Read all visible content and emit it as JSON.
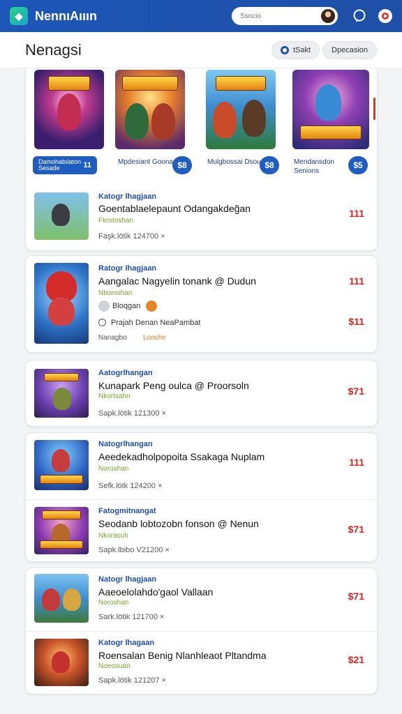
{
  "header": {
    "title": "NennıAııın",
    "search_placeholder": "Ssncio"
  },
  "page": {
    "title": "Nenagsi",
    "chip_1": "tSakt",
    "chip_2": "Dpecasion"
  },
  "featured": [
    {
      "label": "Damohabılaton Sesade",
      "price": "11"
    },
    {
      "label": "Mpdesiant Goonan",
      "price": "$8"
    },
    {
      "label": "Mulgbossai Dsoura",
      "price": "$8"
    },
    {
      "label": "Mendansdon Senions",
      "price": "$5"
    }
  ],
  "items": [
    {
      "category": "Katogr lhagjaan",
      "title": "Goentablaelepaunt Odangakdeğan",
      "tag": "Fkrotoshan",
      "meta": "Faşk.lötik  124700  ×",
      "price": "111"
    },
    {
      "category": "Ratogr lhagjaan",
      "title": "Aangalac Nagyelin tonank @ Dudun",
      "tag": "Nbonıshan",
      "extra_1": "Bloqgan",
      "extra_2": "Prajah Denan NeaPambat",
      "extra_3": "Nanagbo",
      "extra_4": "Lonche",
      "price": "111",
      "price_2": "$11"
    },
    {
      "category": "Aatogrlhangan",
      "title": "Kunapark Peng oulca @ Proorsoln",
      "tag": "Nkortsahn",
      "meta": "Sapk.lötik  121300  ×",
      "price": "$71"
    },
    {
      "category": "Natogrlhangan",
      "title": "Aeedekadholpopoita Ssakaga Nuplam",
      "tag": "Noroshan",
      "meta": "Sefk.lötk  124200  ×",
      "price": "111"
    },
    {
      "category": "Fatogmitnangat",
      "title": "Seodanb lobtozobn fonson @ Nenun",
      "tag": "Nkorasuh",
      "meta": "Sapk.lbibo  V21200  ×",
      "price": "$71"
    },
    {
      "category": "Natogr lhagjaan",
      "title": "Aaeoelolahdo'gaol Vallaan",
      "tag": "Noroshan",
      "meta": "Sark.lötik  121700  ×",
      "price": "$71"
    },
    {
      "category": "Katogr lhagaan",
      "title": "Roensalan Benig Nlanhleaot Pltandma",
      "tag": "Noeosuan",
      "meta": "Sapk.lötik  121207  ×",
      "price": "$21"
    }
  ],
  "colors": {
    "primary": "#1f5ec0",
    "price": "#d32424",
    "category": "#1f4ea8",
    "tag": "#7aa12a"
  },
  "icons": [
    "app-icon",
    "search-avatar",
    "chat-icon",
    "settings-icon",
    "location-icon",
    "close-icon"
  ]
}
